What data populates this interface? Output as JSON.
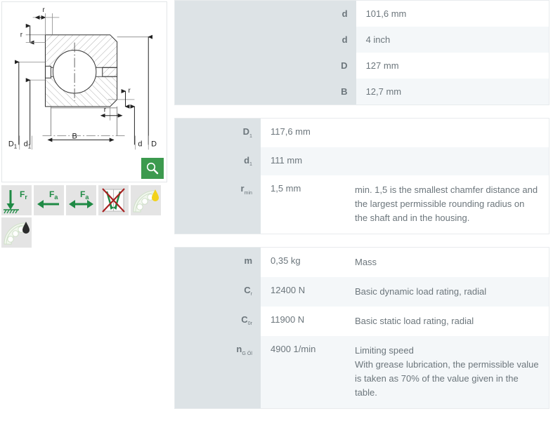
{
  "drawing": {
    "alt": "Angular contact ball bearing cross-section drawing",
    "dimension_labels": {
      "outer_left": "D",
      "inner_left": "d",
      "bottom_left_outer": "D",
      "bottom_left_outer_sub": "1",
      "bottom_left_inner": "d",
      "bottom_left_inner_sub": "1",
      "width": "B",
      "bottom_right_inner": "d",
      "bottom_right_outer": "D",
      "chamfer": "r"
    },
    "chamfer_label": "r",
    "zoom_button": {
      "icon": "magnifier-icon",
      "color": "#3c9a4e"
    }
  },
  "property_icons": [
    {
      "name": "radial-load-icon",
      "label": "F",
      "sub": "r",
      "type": "radial-load"
    },
    {
      "name": "axial-load-one-direction-icon",
      "label": "F",
      "sub": "a",
      "type": "axial-load-single"
    },
    {
      "name": "axial-load-both-directions-icon",
      "label": "F",
      "sub": "a",
      "type": "axial-load-double"
    },
    {
      "name": "misalignment-not-permitted-icon",
      "label": "",
      "sub": "",
      "type": "misalignment-not-permitted"
    },
    {
      "name": "grease-lubrication-icon",
      "label": "",
      "sub": "",
      "type": "grease-lubrication"
    },
    {
      "name": "oil-lubrication-icon",
      "label": "",
      "sub": "",
      "type": "oil-lubrication"
    }
  ],
  "tables": [
    {
      "name": "dimensions-table",
      "rows": [
        {
          "label": "d",
          "label_sub": "",
          "value": "101,6  mm",
          "desc": ""
        },
        {
          "label": "d",
          "label_sub": "",
          "value": "4  inch",
          "desc": ""
        },
        {
          "label": "D",
          "label_sub": "",
          "value": "127  mm",
          "desc": ""
        },
        {
          "label": "B",
          "label_sub": "",
          "value": "12,7  mm",
          "desc": ""
        }
      ]
    },
    {
      "name": "secondary-dimensions-table",
      "rows": [
        {
          "label": "D",
          "label_sub": "1",
          "value": "117,6  mm",
          "desc": ""
        },
        {
          "label": "d",
          "label_sub": "1",
          "value": "111  mm",
          "desc": ""
        },
        {
          "label": "r",
          "label_sub": "min",
          "value": "1,5  mm",
          "desc": "min. 1,5 is the smallest chamfer distance and the largest permissible rounding radius on the shaft and in the housing."
        }
      ]
    },
    {
      "name": "performance-table",
      "rows": [
        {
          "label": "m",
          "label_sub": "",
          "value": "0,35  kg",
          "desc": "Mass"
        },
        {
          "label": "C",
          "label_sub": "r",
          "value": "12400  N",
          "desc": "Basic dynamic load rating, radial"
        },
        {
          "label": "C",
          "label_sub": "0r",
          "value": "11900  N",
          "desc": "Basic static load rating, radial"
        },
        {
          "label": "n",
          "label_sub": "G Öl",
          "value": "4900  1/min",
          "desc": "Limiting speed\nWith grease lubrication, the permissible value is taken as 70% of the value given in the table."
        }
      ]
    }
  ],
  "colors": {
    "label_bg": "#dde3e6",
    "row_alt_bg": "#f4f7f9",
    "text": "#6c767c",
    "accent_green": "#3c9a4e",
    "icon_green": "#1f8a45",
    "icon_red": "#a82020",
    "grease_yellow": "#f2d21a",
    "oil_dark": "#2b2b2b"
  }
}
